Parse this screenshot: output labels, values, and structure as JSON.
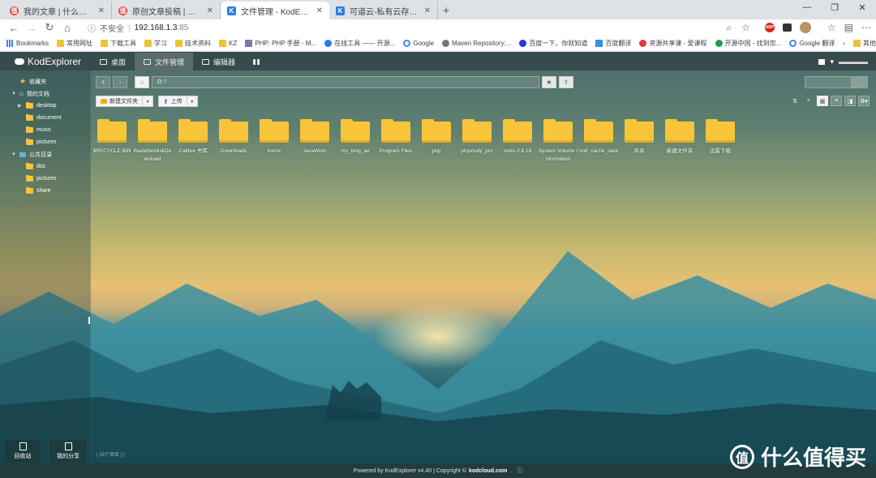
{
  "browser": {
    "tabs": [
      {
        "title": "我的文章 | 什么值得买",
        "favicon": "smzdm",
        "active": false
      },
      {
        "title": "原创文章投稿 | 什么值得买",
        "favicon": "smzdm",
        "active": false
      },
      {
        "title": "文件管理 - KodExplorer - Powered",
        "favicon": "kodexplorer",
        "active": true
      },
      {
        "title": "可道云-私有云存储&协同办公平台",
        "favicon": "kodexplorer",
        "active": false
      }
    ],
    "new_tab": "+",
    "window_controls": {
      "minimize": "—",
      "maximize": "❐",
      "close": "✕"
    },
    "omnibox": {
      "security_label": "不安全",
      "separator": "|",
      "host": "192.168.1.3",
      "port": ":85"
    },
    "bookmarks": [
      {
        "label": "Bookmarks",
        "icon": "apps-icon"
      },
      {
        "label": "常用网址",
        "icon": "folder-icon"
      },
      {
        "label": "下载工具",
        "icon": "folder-icon"
      },
      {
        "label": "学习",
        "icon": "folder-icon"
      },
      {
        "label": "技术资料",
        "icon": "folder-icon"
      },
      {
        "label": "KZ",
        "icon": "folder-icon"
      },
      {
        "label": "PHP: PHP 手册 - M...",
        "icon": "php-icon"
      },
      {
        "label": "在线工具 —— 开源...",
        "icon": "tool-icon"
      },
      {
        "label": "Google",
        "icon": "google-icon"
      },
      {
        "label": "Maven Repository:...",
        "icon": "maven-icon"
      },
      {
        "label": "百度一下，你就知道",
        "icon": "baidu-icon"
      },
      {
        "label": "百度翻译",
        "icon": "translate-icon"
      },
      {
        "label": "资源共享课 - 爱课程",
        "icon": "course-icon"
      },
      {
        "label": "开源中国 - 找到您...",
        "icon": "oschina-icon"
      },
      {
        "label": "Google 翻译",
        "icon": "google-translate-icon"
      }
    ],
    "other_bookmarks": "其他收藏夹"
  },
  "app": {
    "logo": "KodExplorer",
    "nav": [
      {
        "label": "桌面",
        "icon": "desktop-icon",
        "active": false
      },
      {
        "label": "文件管理",
        "icon": "file-manager-icon",
        "active": true
      },
      {
        "label": "编辑器",
        "icon": "editor-icon",
        "active": false
      },
      {
        "label": "",
        "icon": "grid-icon",
        "active": false
      }
    ],
    "sidebar": {
      "favorites": "收藏夹",
      "my_docs": "我的文档",
      "my_docs_children": [
        "desktop",
        "document",
        "music",
        "pictures"
      ],
      "public": "公共目录",
      "public_children": [
        "doc",
        "pictures",
        "share"
      ]
    },
    "sidebar_buttons": [
      {
        "label": "回收站",
        "icon": "trash-icon"
      },
      {
        "label": "我的分享",
        "icon": "share-icon"
      }
    ],
    "path": "D: /",
    "toolbar": {
      "new_folder": "新建文件夹",
      "upload": "上传"
    },
    "files": [
      "$RECYCLE.BIN",
      "BaiduNetdiskDownload",
      "Calibre 书库",
      "Downloads",
      "home",
      "JavaWork",
      "my_blog_jar",
      "Program Files",
      "php",
      "phpstudy_pro",
      "redis-2.8.19",
      "System Volume Information",
      "vod_cache_data",
      "共享",
      "新建文件夹",
      "迅雷下载"
    ],
    "item_count": "16个项目",
    "item_count_separator": "|",
    "footer": {
      "prefix": "Powered by KodExplorer v4.40 | Copyright ©",
      "site": "kodcloud.com",
      "suffix": "."
    }
  },
  "watermark": {
    "glyph": "值",
    "text": "什么值得买"
  }
}
